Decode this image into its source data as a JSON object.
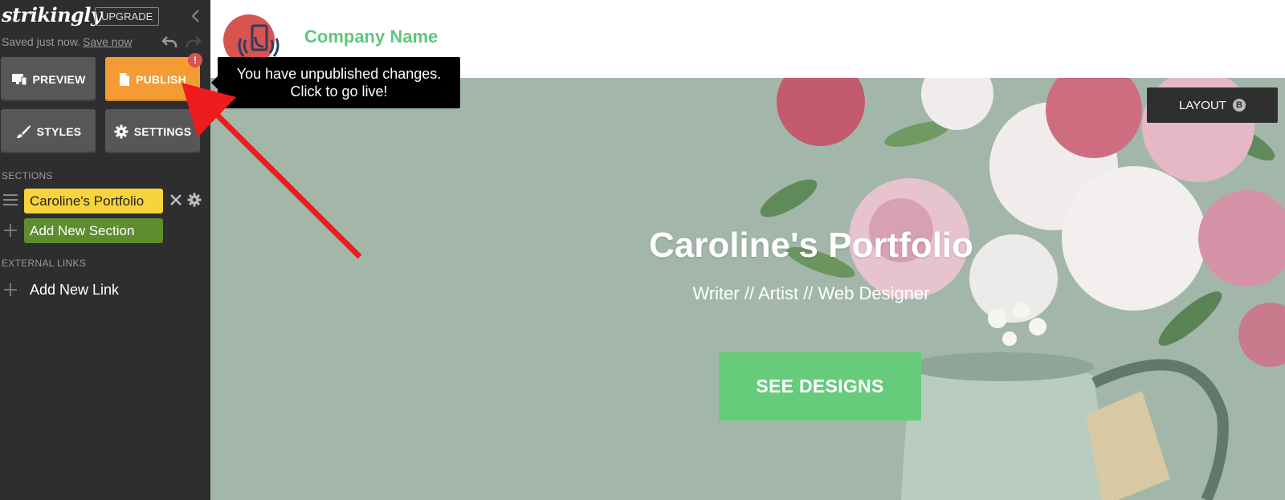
{
  "sidebar": {
    "logo": "strikingly",
    "upgrade_label": "UPGRADE",
    "saved_text": "Saved just now.",
    "save_now_label": "Save now",
    "preview_label": "PREVIEW",
    "publish_label": "PUBLISH",
    "publish_badge": "!",
    "styles_label": "STYLES",
    "settings_label": "SETTINGS",
    "sections_heading": "SECTIONS",
    "sections": [
      {
        "label": "Caroline's Portfolio"
      }
    ],
    "add_section_label": "Add New Section",
    "external_links_heading": "EXTERNAL LINKS",
    "add_link_label": "Add New Link"
  },
  "tooltip": {
    "line1": "You have unpublished changes.",
    "line2": "Click to go live!"
  },
  "header": {
    "company_name": "Company Name"
  },
  "hero": {
    "title": "Caroline's Portfolio",
    "subtitle": "Writer // Artist // Web Designer",
    "cta_label": "SEE DESIGNS",
    "layout_label": "LAYOUT",
    "layout_badge": "B"
  },
  "colors": {
    "sidebar_bg": "#2e2e2e",
    "publish_orange": "#f49b34",
    "section_yellow": "#f7d33d",
    "add_section_green": "#5d8d2e",
    "brand_green": "#5cc97e",
    "cta_green": "#66cc7c",
    "hero_bg": "#a2b7aa",
    "annotation_red": "#ee1c1c"
  }
}
